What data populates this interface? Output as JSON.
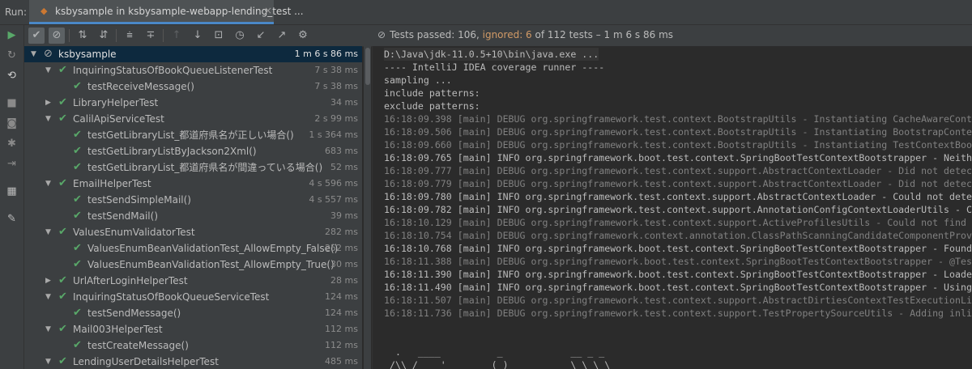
{
  "tabbar": {
    "run_label": "Run:",
    "tab_title": "ksbysample in ksbysample-webapp-lending_test ...",
    "tab_icon": "run-config-icon",
    "close_icon": "close-icon"
  },
  "left_toolbar": [
    "rerun-icon",
    "rerun-failed-icon",
    "toggle-auto-test-icon",
    "stop-icon",
    "camera-icon",
    "settings-icon",
    "exit-icon",
    "layout-icon",
    "pin-icon"
  ],
  "toolbar": {
    "buttons": [
      "show-passed-icon",
      "show-ignored-icon",
      "sort-alpha-icon",
      "sort-duration-icon",
      "expand-all-icon",
      "collapse-all-icon",
      "prev-failed-icon",
      "next-failed-icon",
      "import-tests-icon",
      "history-icon",
      "export-icon",
      "open-external-icon",
      "settings-icon"
    ],
    "status_prefix": "Tests passed: 106, ",
    "status_ignored": "ignored: 6",
    "status_suffix": " of 112 tests – 1 m 6 s 86 ms"
  },
  "tree": {
    "rows": [
      {
        "label": "ksbysample",
        "duration": "1 m 6 s 86 ms",
        "status": "ignored",
        "level": 0,
        "expandable": true,
        "selected": true
      },
      {
        "label": "InquiringStatusOfBookQueueListenerTest",
        "duration": "7 s 38 ms",
        "status": "passed",
        "level": 1,
        "expandable": true
      },
      {
        "label": "testReceiveMessage()",
        "duration": "7 s 38 ms",
        "status": "passed",
        "level": 2,
        "expandable": false
      },
      {
        "label": "LibraryHelperTest",
        "duration": "34 ms",
        "status": "passed",
        "level": 1,
        "expandable": true,
        "collapsed": true
      },
      {
        "label": "CalilApiServiceTest",
        "duration": "2 s 99 ms",
        "status": "passed",
        "level": 1,
        "expandable": true
      },
      {
        "label": "testGetLibraryList_都道府県名が正しい場合()",
        "duration": "1 s 364 ms",
        "status": "passed",
        "level": 2,
        "expandable": false
      },
      {
        "label": "testGetLibraryListByJackson2Xml()",
        "duration": "683 ms",
        "status": "passed",
        "level": 2,
        "expandable": false
      },
      {
        "label": "testGetLibraryList_都道府県名が間違っている場合()",
        "duration": "52 ms",
        "status": "passed",
        "level": 2,
        "expandable": false
      },
      {
        "label": "EmailHelperTest",
        "duration": "4 s 596 ms",
        "status": "passed",
        "level": 1,
        "expandable": true
      },
      {
        "label": "testSendSimpleMail()",
        "duration": "4 s 557 ms",
        "status": "passed",
        "level": 2,
        "expandable": false
      },
      {
        "label": "testSendMail()",
        "duration": "39 ms",
        "status": "passed",
        "level": 2,
        "expandable": false
      },
      {
        "label": "ValuesEnumValidatorTest",
        "duration": "282 ms",
        "status": "passed",
        "level": 1,
        "expandable": true
      },
      {
        "label": "ValuesEnumBeanValidationTest_AllowEmpty_False()",
        "duration": "252 ms",
        "status": "passed",
        "level": 2,
        "expandable": false
      },
      {
        "label": "ValuesEnumBeanValidationTest_AllowEmpty_True()",
        "duration": "30 ms",
        "status": "passed",
        "level": 2,
        "expandable": false
      },
      {
        "label": "UrlAfterLoginHelperTest",
        "duration": "28 ms",
        "status": "passed",
        "level": 1,
        "expandable": true,
        "collapsed": true
      },
      {
        "label": "InquiringStatusOfBookQueueServiceTest",
        "duration": "124 ms",
        "status": "passed",
        "level": 1,
        "expandable": true
      },
      {
        "label": "testSendMessage()",
        "duration": "124 ms",
        "status": "passed",
        "level": 2,
        "expandable": false
      },
      {
        "label": "Mail003HelperTest",
        "duration": "112 ms",
        "status": "passed",
        "level": 1,
        "expandable": true
      },
      {
        "label": "testCreateMessage()",
        "duration": "112 ms",
        "status": "passed",
        "level": 2,
        "expandable": false
      },
      {
        "label": "LendingUserDetailsHelperTest",
        "duration": "485 ms",
        "status": "passed",
        "level": 1,
        "expandable": true
      }
    ]
  },
  "console": {
    "lines": [
      {
        "text": "D:\\Java\\jdk-11.0.5+10\\bin\\java.exe ...",
        "style": "plain",
        "highlight": true
      },
      {
        "text": "---- IntelliJ IDEA coverage runner ----",
        "style": "plain"
      },
      {
        "text": "sampling ...",
        "style": "plain"
      },
      {
        "text": "include patterns:",
        "style": "plain"
      },
      {
        "text": "exclude patterns:",
        "style": "plain"
      },
      {
        "text": "16:18:09.398 [main] DEBUG org.springframework.test.context.BootstrapUtils - Instantiating CacheAwareContextLoaderDelegate",
        "style": "dim"
      },
      {
        "text": "16:18:09.506 [main] DEBUG org.springframework.test.context.BootstrapUtils - Instantiating BootstrapContext",
        "style": "dim"
      },
      {
        "text": "16:18:09.660 [main] DEBUG org.springframework.test.context.BootstrapUtils - Instantiating TestContextBootstrapper",
        "style": "dim"
      },
      {
        "text": "16:18:09.765 [main] INFO org.springframework.boot.test.context.SpringBootTestContextBootstrapper - Neither",
        "style": "info"
      },
      {
        "text": "16:18:09.777 [main] DEBUG org.springframework.test.context.support.AbstractContextLoader - Did not detect",
        "style": "dim"
      },
      {
        "text": "16:18:09.779 [main] DEBUG org.springframework.test.context.support.AbstractContextLoader - Did not detect",
        "style": "dim"
      },
      {
        "text": "16:18:09.780 [main] INFO org.springframework.test.context.support.AbstractContextLoader - Could not detect",
        "style": "info"
      },
      {
        "text": "16:18:09.782 [main] INFO org.springframework.test.context.support.AnnotationConfigContextLoaderUtils - Could",
        "style": "info"
      },
      {
        "text": "16:18:10.129 [main] DEBUG org.springframework.test.context.support.ActiveProfilesUtils - Could not find",
        "style": "dim"
      },
      {
        "text": "16:18:10.754 [main] DEBUG org.springframework.context.annotation.ClassPathScanningCandidateComponentProvider",
        "style": "dim"
      },
      {
        "text": "16:18:10.768 [main] INFO org.springframework.boot.test.context.SpringBootTestContextBootstrapper - Found",
        "style": "info"
      },
      {
        "text": "16:18:11.388 [main] DEBUG org.springframework.boot.test.context.SpringBootTestContextBootstrapper - @Test",
        "style": "dim"
      },
      {
        "text": "16:18:11.390 [main] INFO org.springframework.boot.test.context.SpringBootTestContextBootstrapper - Loaded",
        "style": "info"
      },
      {
        "text": "16:18:11.490 [main] INFO org.springframework.boot.test.context.SpringBootTestContextBootstrapper - Using",
        "style": "info"
      },
      {
        "text": "16:18:11.507 [main] DEBUG org.springframework.test.context.support.AbstractDirtiesContextTestExecutionListener",
        "style": "dim"
      },
      {
        "text": "16:18:11.736 [main] DEBUG org.springframework.test.context.support.TestPropertySourceUtils - Adding inlined",
        "style": "dim"
      },
      {
        "text": "",
        "style": "plain"
      },
      {
        "text": "",
        "style": "plain"
      },
      {
        "text": "  .   ____          _            __ _ _",
        "style": "plain"
      },
      {
        "text": " /\\\\ / ___'_ __ _ _(_)_ __  __ _ \\ \\ \\ \\",
        "style": "plain"
      },
      {
        "text": "( ( )\\___ | '_ | '_| | '_ \\/ _` | \\ \\ \\ \\",
        "style": "plain"
      }
    ]
  },
  "colors": {
    "passed": "#59a869",
    "ignored_text": "#d19a66",
    "selection": "#0d293e",
    "accent": "#4a88c7"
  }
}
